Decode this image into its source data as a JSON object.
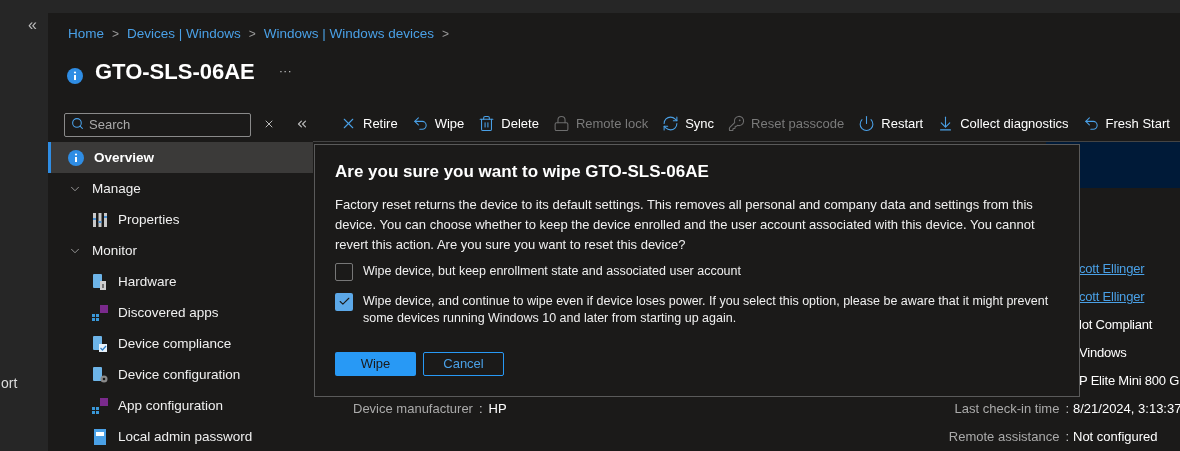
{
  "nav_collapse": "«",
  "nav_partial_label": "ort",
  "breadcrumb": [
    "Home",
    "Devices | Windows",
    "Windows | Windows devices"
  ],
  "separator": ">",
  "title": "GTO-SLS-06AE",
  "more": "···",
  "search": {
    "placeholder": "Search"
  },
  "toolbar": [
    {
      "label": "Retire",
      "disabled": false
    },
    {
      "label": "Wipe",
      "disabled": false
    },
    {
      "label": "Delete",
      "disabled": false
    },
    {
      "label": "Remote lock",
      "disabled": true
    },
    {
      "label": "Sync",
      "disabled": false
    },
    {
      "label": "Reset passcode",
      "disabled": true
    },
    {
      "label": "Restart",
      "disabled": false
    },
    {
      "label": "Collect diagnostics",
      "disabled": false
    },
    {
      "label": "Fresh Start",
      "disabled": false
    }
  ],
  "sidebar": [
    {
      "kind": "item",
      "label": "Overview",
      "selected": true
    },
    {
      "kind": "group",
      "label": "Manage",
      "expanded": true,
      "children": [
        {
          "kind": "item",
          "label": "Properties",
          "selected": false
        }
      ]
    },
    {
      "kind": "group",
      "label": "Monitor",
      "expanded": true,
      "children": [
        {
          "kind": "item",
          "label": "Hardware",
          "selected": false
        },
        {
          "kind": "item",
          "label": "Discovered apps",
          "selected": false
        },
        {
          "kind": "item",
          "label": "Device compliance",
          "selected": false
        },
        {
          "kind": "item",
          "label": "Device configuration",
          "selected": false
        },
        {
          "kind": "item",
          "label": "App configuration",
          "selected": false
        },
        {
          "kind": "item",
          "label": "Local admin password",
          "selected": false
        }
      ]
    }
  ],
  "properties": [
    {
      "right": {
        "value": "cott Ellinger",
        "link": true
      }
    },
    {
      "right": {
        "value": "cott Ellinger",
        "link": true
      }
    },
    {
      "right": {
        "value": "lot Compliant",
        "link": false
      }
    },
    {
      "right": {
        "value": "Vindows",
        "link": false
      }
    },
    {
      "right": {
        "value": "P Elite Mini 800 G",
        "link": false
      }
    },
    {
      "left": {
        "label": "Device manufacturer",
        "value": "HP"
      },
      "right": {
        "label": "Last check-in time",
        "value": "8/21/2024, 3:13:37",
        "link": false
      }
    },
    {
      "right": {
        "label": "Remote assistance",
        "value": "Not configured",
        "link": false
      }
    }
  ],
  "colon": ":",
  "dialog": {
    "title": "Are you sure you want to wipe GTO-SLS-06AE",
    "body": "Factory reset returns the device to its default settings. This removes all personal and company data and settings from this device. You can choose whether to keep the device enrolled and the user account associated with this device. You cannot revert this action. Are you sure you want to reset this device?",
    "options": [
      {
        "label": "Wipe device, but keep enrollment state and associated user account",
        "checked": false
      },
      {
        "label": "Wipe device, and continue to wipe even if device loses power. If you select this option, please be aware that it might prevent some devices running Windows 10 and later from starting up again.",
        "checked": true
      }
    ],
    "buttons": [
      {
        "label": "Wipe",
        "kind": "primary"
      },
      {
        "label": "Cancel",
        "kind": "secondary"
      }
    ]
  }
}
